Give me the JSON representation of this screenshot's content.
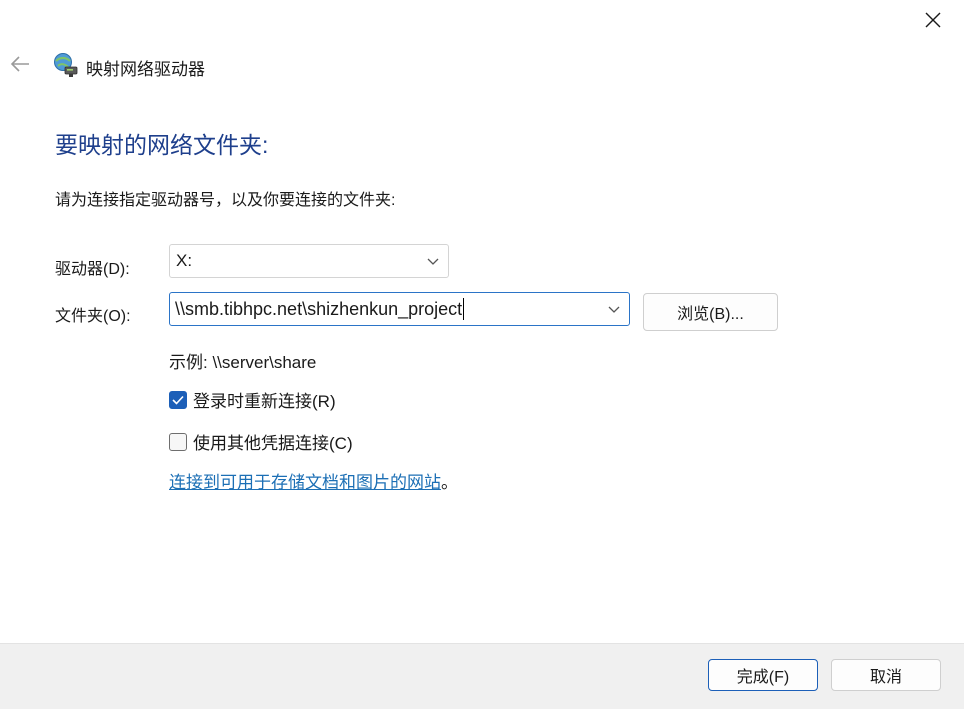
{
  "window": {
    "title": "映射网络驱动器",
    "title_icon": "network-drive-icon",
    "close_icon": "close-icon",
    "back_icon": "back-arrow-icon"
  },
  "main": {
    "heading": "要映射的网络文件夹:",
    "instruction": "请为连接指定驱动器号，以及你要连接的文件夹:",
    "drive_label": "驱动器(D):",
    "drive_value": "X:",
    "folder_label": "文件夹(O):",
    "folder_value": "\\\\smb.tibhpc.net\\shizhenkun_project",
    "browse_label": "浏览(B)...",
    "example": "示例: \\\\server\\share",
    "reconnect_label": "登录时重新连接(R)",
    "reconnect_checked": true,
    "other_credentials_label": "使用其他凭据连接(C)",
    "other_credentials_checked": false,
    "link_text": "连接到可用于存储文档和图片的网站",
    "link_suffix": "。"
  },
  "footer": {
    "finish_label": "完成(F)",
    "cancel_label": "取消"
  },
  "colors": {
    "heading": "#1e3f8c",
    "link": "#1c6fb5",
    "checkbox_checked": "#1c5fb8",
    "input_focus_border": "#2b74c7",
    "footer_bg": "#f0f0f0"
  }
}
